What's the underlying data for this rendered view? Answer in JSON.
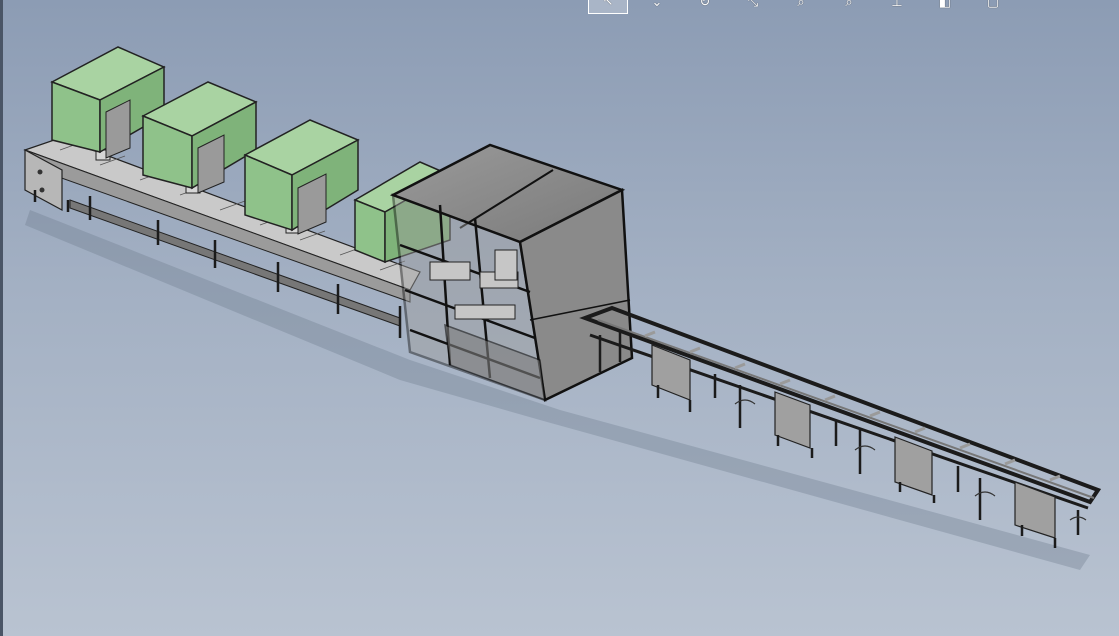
{
  "viewport": {
    "background_top": "#8c9cb4",
    "background_bottom": "#b9c3d1",
    "model_colors": {
      "enclosure_green": "#92c48d",
      "cabinet_grey": "#8a8a8a",
      "frame_dark": "#1b1b1b",
      "panel_light": "#c8c8c8"
    }
  },
  "toolbar": {
    "items": [
      {
        "icon": "select-arrow-icon",
        "glyph": "↖",
        "active": true
      },
      {
        "icon": "chevron-down-icon",
        "glyph": "⌄",
        "active": false
      },
      {
        "icon": "rotate-view-icon",
        "glyph": "↻",
        "active": false
      },
      {
        "icon": "pan-icon",
        "glyph": "⤡",
        "active": false
      },
      {
        "icon": "zoom-fit-icon",
        "glyph": "⌕",
        "active": false
      },
      {
        "icon": "zoom-area-icon",
        "glyph": "⌕",
        "active": false
      },
      {
        "icon": "section-view-icon",
        "glyph": "⊥",
        "active": false
      },
      {
        "icon": "display-style-icon",
        "glyph": "◧",
        "active": false
      },
      {
        "icon": "view-orientation-icon",
        "glyph": "▢",
        "active": false
      }
    ]
  }
}
